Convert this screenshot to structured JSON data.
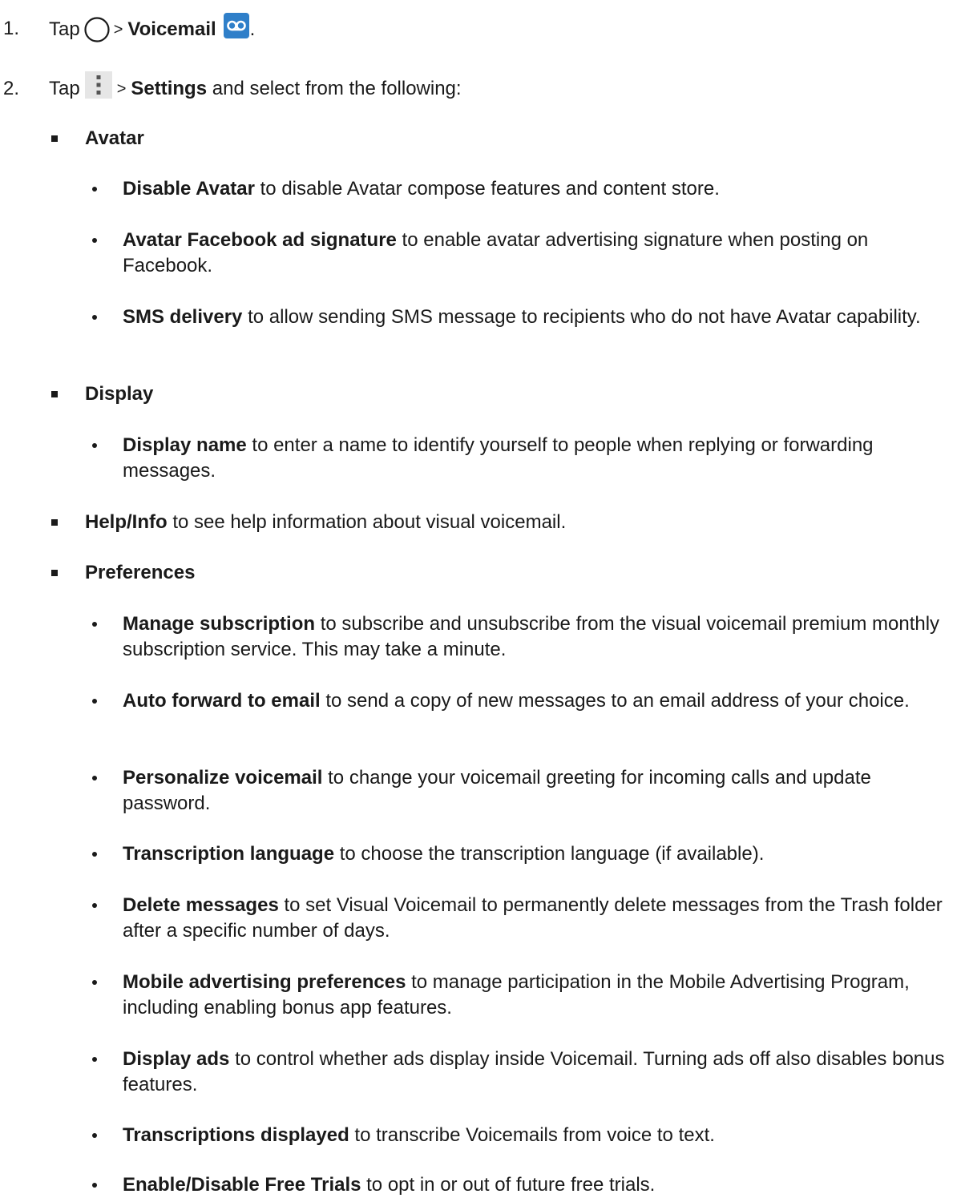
{
  "steps": [
    {
      "num": "1.",
      "pre": "Tap",
      "sep": ">",
      "bold": "Voicemail",
      "post": ".",
      "home_icon": "home-circle-icon",
      "app_icon": "voicemail-app-icon"
    },
    {
      "num": "2.",
      "pre": "Tap",
      "sep": ">",
      "bold": "Settings",
      "post": " and select from the following:",
      "menu_icon": "more-options-icon"
    }
  ],
  "sections": [
    {
      "bold": "Avatar",
      "text": "",
      "items": [
        {
          "bold": "Disable Avatar",
          "text": " to disable Avatar compose features and content store."
        },
        {
          "bold": "Avatar Facebook ad signature",
          "text": " to enable avatar advertising signature when posting on Facebook."
        },
        {
          "bold": "SMS delivery",
          "text": " to allow sending SMS message to recipients who do not have Avatar capability."
        }
      ]
    },
    {
      "bold": "Display",
      "text": "",
      "items": [
        {
          "bold": "Display name",
          "text": " to enter a name to identify yourself to people when replying or forwarding messages."
        }
      ]
    },
    {
      "bold": "Help/Info",
      "text": " to see help information about visual voicemail.",
      "items": []
    },
    {
      "bold": "Preferences",
      "text": "",
      "items": [
        {
          "bold": "Manage subscription",
          "text": " to subscribe and unsubscribe from the visual voicemail premium monthly subscription service. This may take a minute."
        },
        {
          "bold": "Auto forward to email",
          "text": " to send a copy of new messages to an email address of your choice."
        },
        {
          "bold": "Personalize voicemail",
          "text": " to change your voicemail greeting for incoming calls and update password."
        },
        {
          "bold": "Transcription language",
          "text": " to choose the transcription language (if available)."
        },
        {
          "bold": "Delete messages",
          "text": " to set Visual Voicemail to permanently delete messages from the Trash folder after a specific number of days."
        },
        {
          "bold": "Mobile advertising preferences",
          "text": " to manage participation in the Mobile Advertising Program, including enabling bonus app features."
        },
        {
          "bold": "Display ads",
          "text": " to control whether ads display inside Voicemail. Turning ads off also disables bonus features."
        },
        {
          "bold": "Transcriptions displayed",
          "text": " to transcribe Voicemails from voice to text."
        },
        {
          "bold": "Enable/Disable Free Trials",
          "text": " to opt in or out of future free trials."
        }
      ]
    }
  ],
  "colors": {
    "text": "#1a1a1a",
    "voicemail_icon_bg": "#2f7fc9",
    "menu_icon_bg": "#e6e6e6"
  }
}
